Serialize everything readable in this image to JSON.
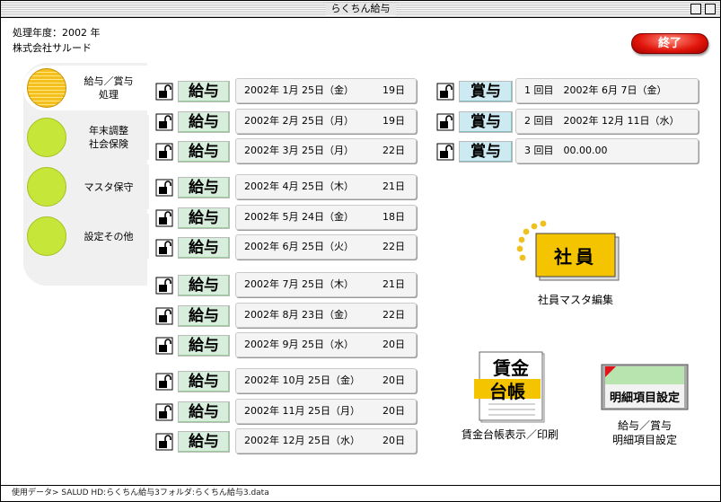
{
  "window": {
    "title": "らくちん給与"
  },
  "header": {
    "fiscal_year": "処理年度：2002 年",
    "company": "株式会社サルード"
  },
  "end_button": "終了",
  "sidebar": {
    "items": [
      {
        "label": "給与／賞与\n処理",
        "active": true
      },
      {
        "label": "年末調整\n社会保険",
        "active": false
      },
      {
        "label": "マスタ保守",
        "active": false
      },
      {
        "label": "設定その他",
        "active": false
      }
    ]
  },
  "salary_tag": "給与",
  "bonus_tag": "賞与",
  "salary_rows": [
    {
      "date": "2002年 1月 25日（金）",
      "days": "19日"
    },
    {
      "date": "2002年 2月 25日（月）",
      "days": "19日"
    },
    {
      "date": "2002年 3月 25日（月）",
      "days": "22日"
    },
    {
      "date": "2002年 4月 25日（木）",
      "days": "21日"
    },
    {
      "date": "2002年 5月 24日（金）",
      "days": "18日"
    },
    {
      "date": "2002年 6月 25日（火）",
      "days": "22日"
    },
    {
      "date": "2002年 7月 25日（木）",
      "days": "21日"
    },
    {
      "date": "2002年 8月 23日（金）",
      "days": "22日"
    },
    {
      "date": "2002年 9月 25日（水）",
      "days": "20日"
    },
    {
      "date": "2002年 10月 25日（金）",
      "days": "20日"
    },
    {
      "date": "2002年 11月 25日（月）",
      "days": "20日"
    },
    {
      "date": "2002年 12月 25日（水）",
      "days": "20日"
    }
  ],
  "bonus_rows": [
    {
      "label": "1 回目　2002年 6月 7日（金）"
    },
    {
      "label": "2 回目　2002年 12月 11日（水）"
    },
    {
      "label": "3 回目　00.00.00"
    }
  ],
  "shortcuts": {
    "employee": {
      "icon_text": "社員",
      "label": "社員マスタ編集"
    },
    "ledger": {
      "icon_text_1": "賃金",
      "icon_text_2": "台帳",
      "label": "賃金台帳表示／印刷"
    },
    "detail": {
      "icon_text": "明細項目設定",
      "label": "給与／賞与\n明細項目設定"
    }
  },
  "status": "使用データ>  SALUD HD:らくちん給与3フォルダ:らくちん給与3.data",
  "colors": {
    "end_button": "#e0140a",
    "salary_tag": "#d8eedd",
    "bonus_tag": "#cde9f2",
    "sidebar_circle": "#c6e63a",
    "active_circle": "#f4c020"
  }
}
